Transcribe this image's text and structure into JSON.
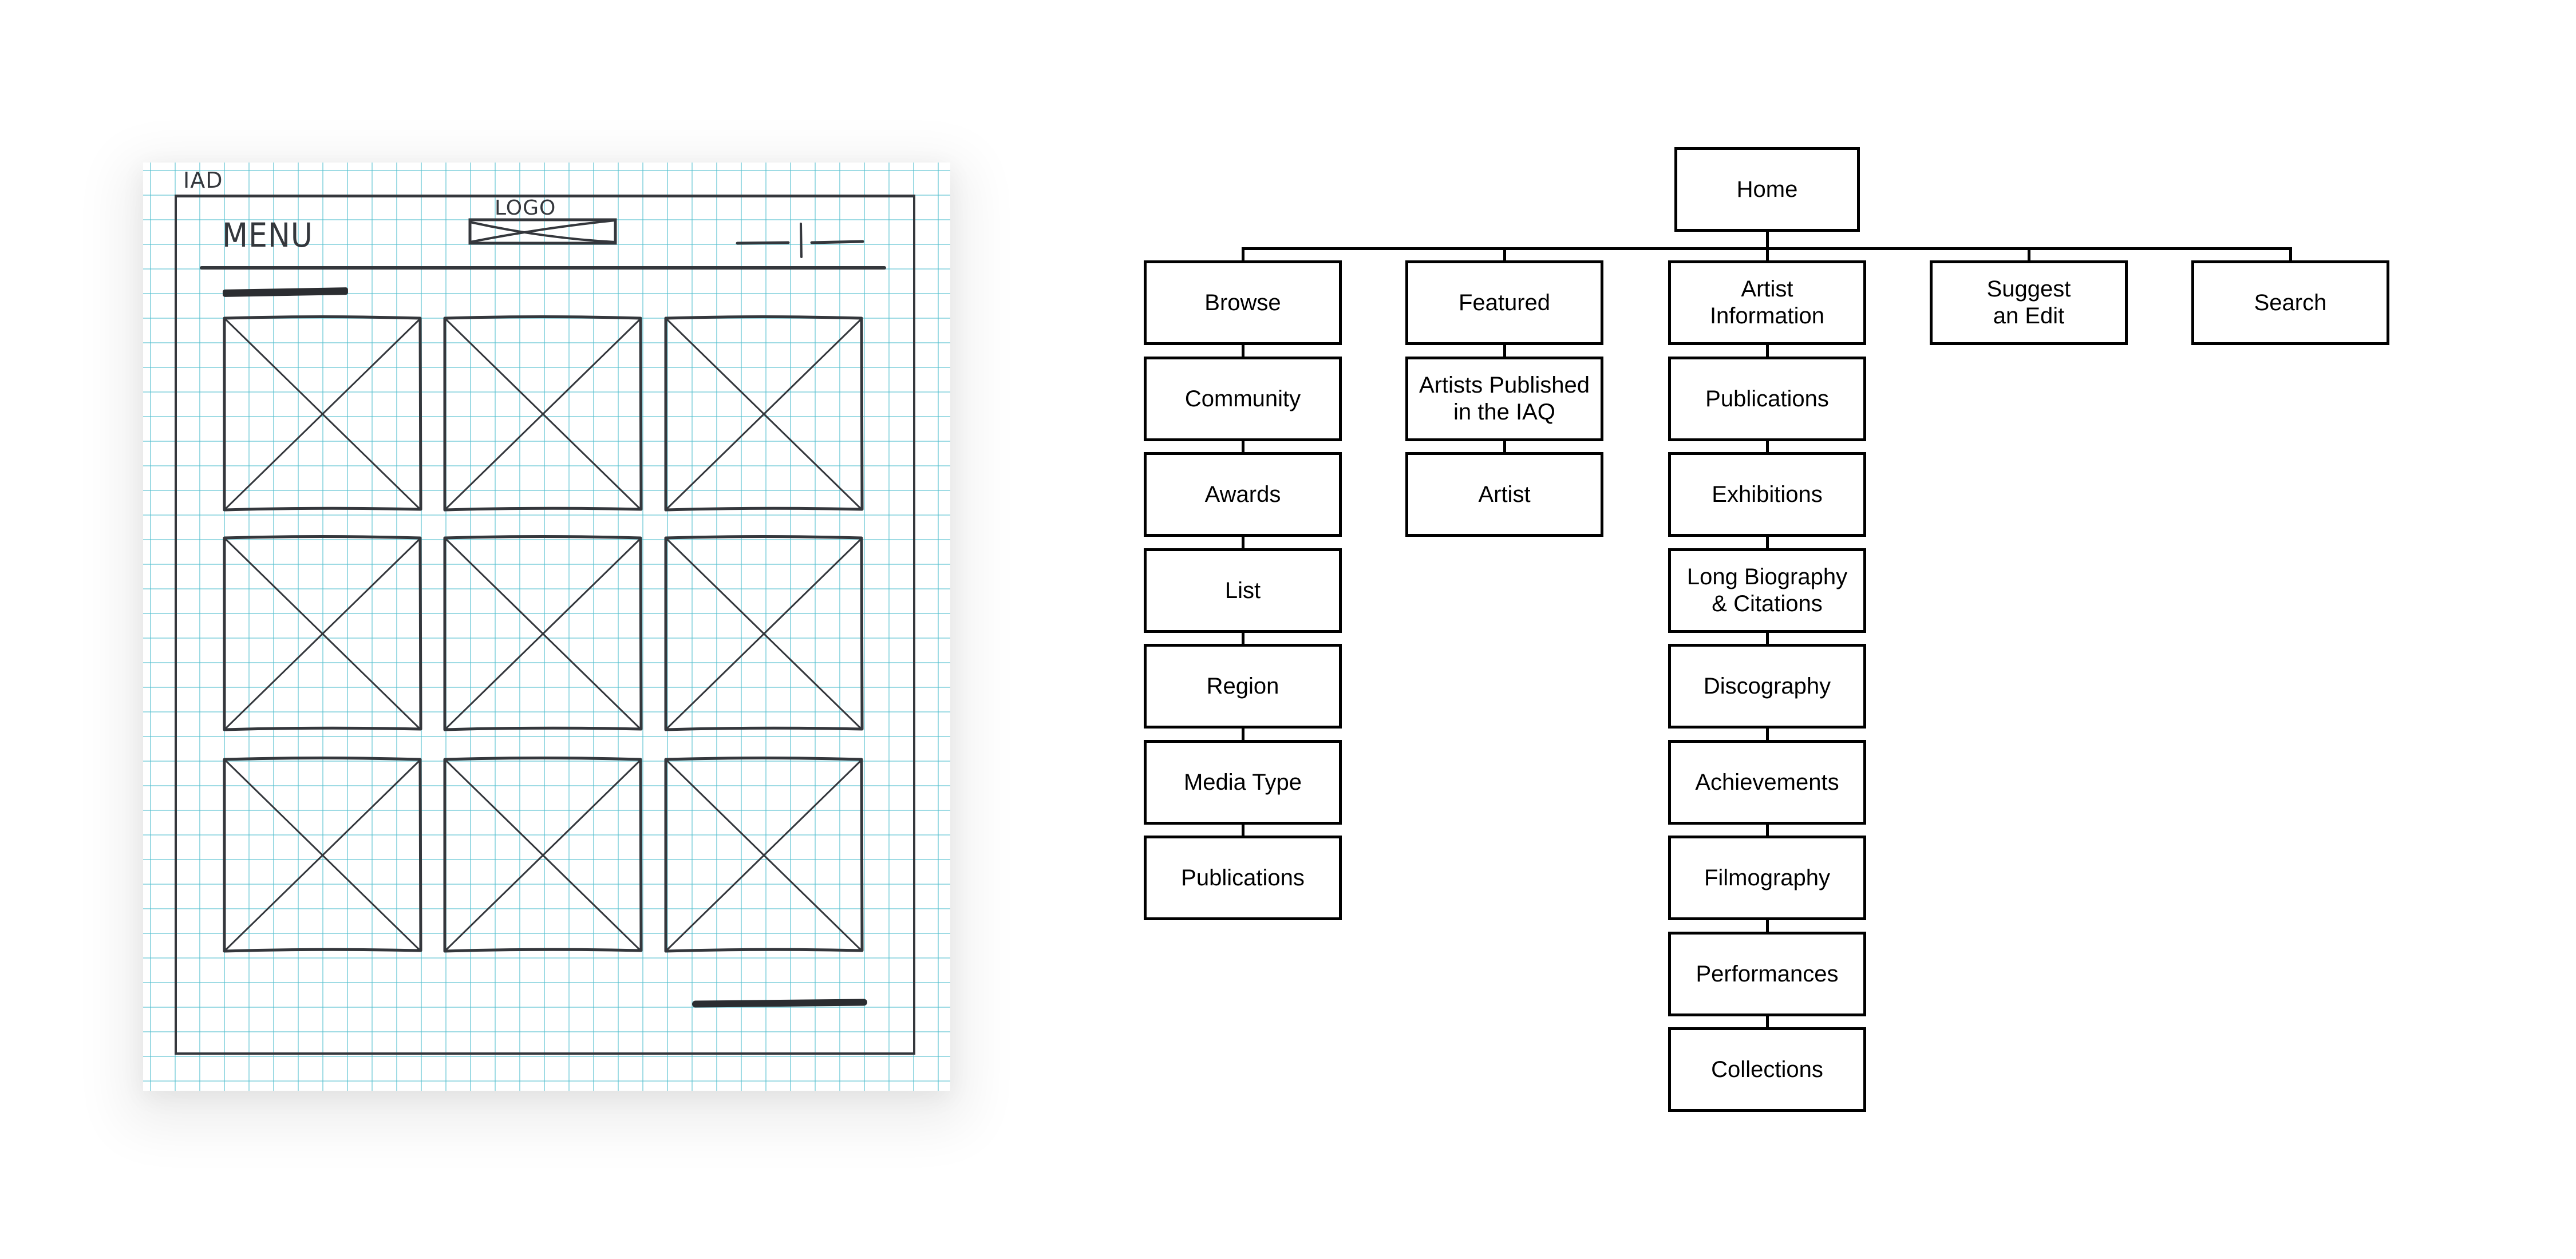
{
  "sketch": {
    "corner_label": "IAD",
    "menu_label": "MENU",
    "logo_label": "LOGO",
    "header_icon": "search-icon",
    "tile_grid": {
      "rows": 3,
      "columns": 3,
      "tile_icon": "image-placeholder-icon"
    },
    "colors": {
      "ink": "#34373c",
      "grid": "#50becd",
      "paper": "#ffffff"
    }
  },
  "sitemap": {
    "root": {
      "label": "Home"
    },
    "sections": [
      {
        "label": "Browse",
        "children": [
          "Community",
          "Awards",
          "List",
          "Region",
          "Media Type",
          "Publications"
        ]
      },
      {
        "label": "Featured",
        "children": [
          "Artists Published\nin the IAQ",
          "Artist"
        ]
      },
      {
        "label": "Artist\nInformation",
        "children": [
          "Publications",
          "Exhibitions",
          "Long Biography\n& Citations",
          "Discography",
          "Achievements",
          "Filmography",
          "Performances",
          "Collections"
        ]
      },
      {
        "label": "Suggest\nan Edit",
        "children": []
      },
      {
        "label": "Search",
        "children": []
      }
    ],
    "colors": {
      "stroke": "#000000",
      "text": "#000000",
      "fill": "#ffffff"
    }
  }
}
